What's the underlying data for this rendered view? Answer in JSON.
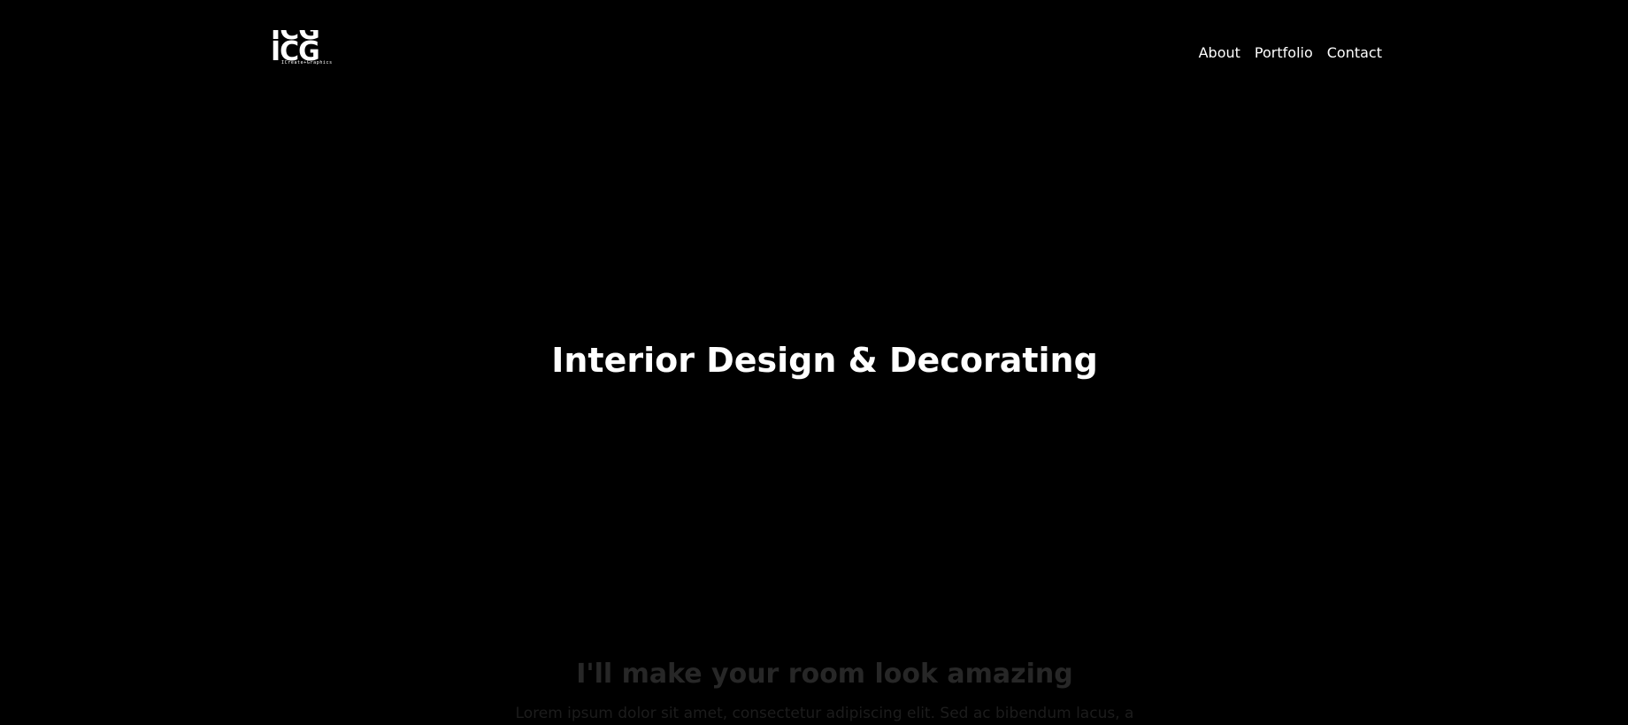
{
  "logo": {
    "line1": "ICG",
    "line2": "ICG",
    "tagline": "ICreate+Graphics"
  },
  "nav": {
    "items": [
      {
        "label": "About"
      },
      {
        "label": "Portfolio"
      },
      {
        "label": "Contact"
      }
    ]
  },
  "hero": {
    "title": "Interior Design & Decorating"
  },
  "intro": {
    "heading": "I'll make your room look amazing",
    "text": "Lorem ipsum dolor sit amet, consectetur adipiscing elit. Sed ac bibendum lacus, a"
  },
  "colors": {
    "background": "#000000",
    "text": "#ffffff",
    "faded_heading": "#272727",
    "faded_text": "#1c1c1c"
  }
}
